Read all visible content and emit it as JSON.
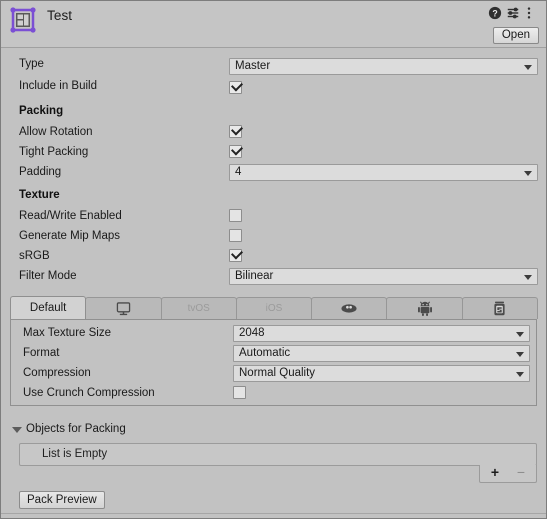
{
  "window": {
    "title": "Test",
    "bg_color": "#c2c2c2",
    "field_color": "#dcdcdc"
  },
  "header": {
    "icon_name": "sprite-atlas-icon",
    "title": "Test",
    "help_icon": "help-icon",
    "preset_icon": "preset-settings-icon",
    "menu_icon": "kebab-menu-icon",
    "open_label": "Open"
  },
  "general": {
    "type_label": "Type",
    "type_value": "Master",
    "include_in_build_label": "Include in Build",
    "include_in_build_checked": true
  },
  "packing": {
    "section_title": "Packing",
    "allow_rotation_label": "Allow Rotation",
    "allow_rotation_checked": true,
    "tight_packing_label": "Tight Packing",
    "tight_packing_checked": true,
    "padding_label": "Padding",
    "padding_value": "4"
  },
  "texture": {
    "section_title": "Texture",
    "read_write_label": "Read/Write Enabled",
    "read_write_checked": false,
    "mipmaps_label": "Generate Mip Maps",
    "mipmaps_checked": false,
    "srgb_label": "sRGB",
    "srgb_checked": true,
    "filter_mode_label": "Filter Mode",
    "filter_mode_value": "Bilinear"
  },
  "platform_tabs": [
    {
      "label": "Default",
      "icon": "",
      "active": true,
      "dim": false
    },
    {
      "label": "",
      "icon": "standalone-monitor-icon",
      "active": false,
      "dim": false
    },
    {
      "label": "tvOS",
      "icon": "",
      "active": false,
      "dim": true
    },
    {
      "label": "iOS",
      "icon": "",
      "active": false,
      "dim": true
    },
    {
      "label": "",
      "icon": "webgl-icon",
      "active": false,
      "dim": false
    },
    {
      "label": "",
      "icon": "android-robot-icon",
      "active": false,
      "dim": false
    },
    {
      "label": "",
      "icon": "dedicated-server-icon",
      "active": false,
      "dim": false
    }
  ],
  "platform_settings": {
    "max_texture_size_label": "Max Texture Size",
    "max_texture_size_value": "2048",
    "format_label": "Format",
    "format_value": "Automatic",
    "compression_label": "Compression",
    "compression_value": "Normal Quality",
    "crunch_label": "Use Crunch Compression",
    "crunch_checked": false
  },
  "objects_for_packing": {
    "title": "Objects for Packing",
    "expanded": true,
    "empty_text": "List is Empty",
    "add_label": "+",
    "remove_label": "−"
  },
  "footer": {
    "pack_preview_label": "Pack Preview"
  }
}
